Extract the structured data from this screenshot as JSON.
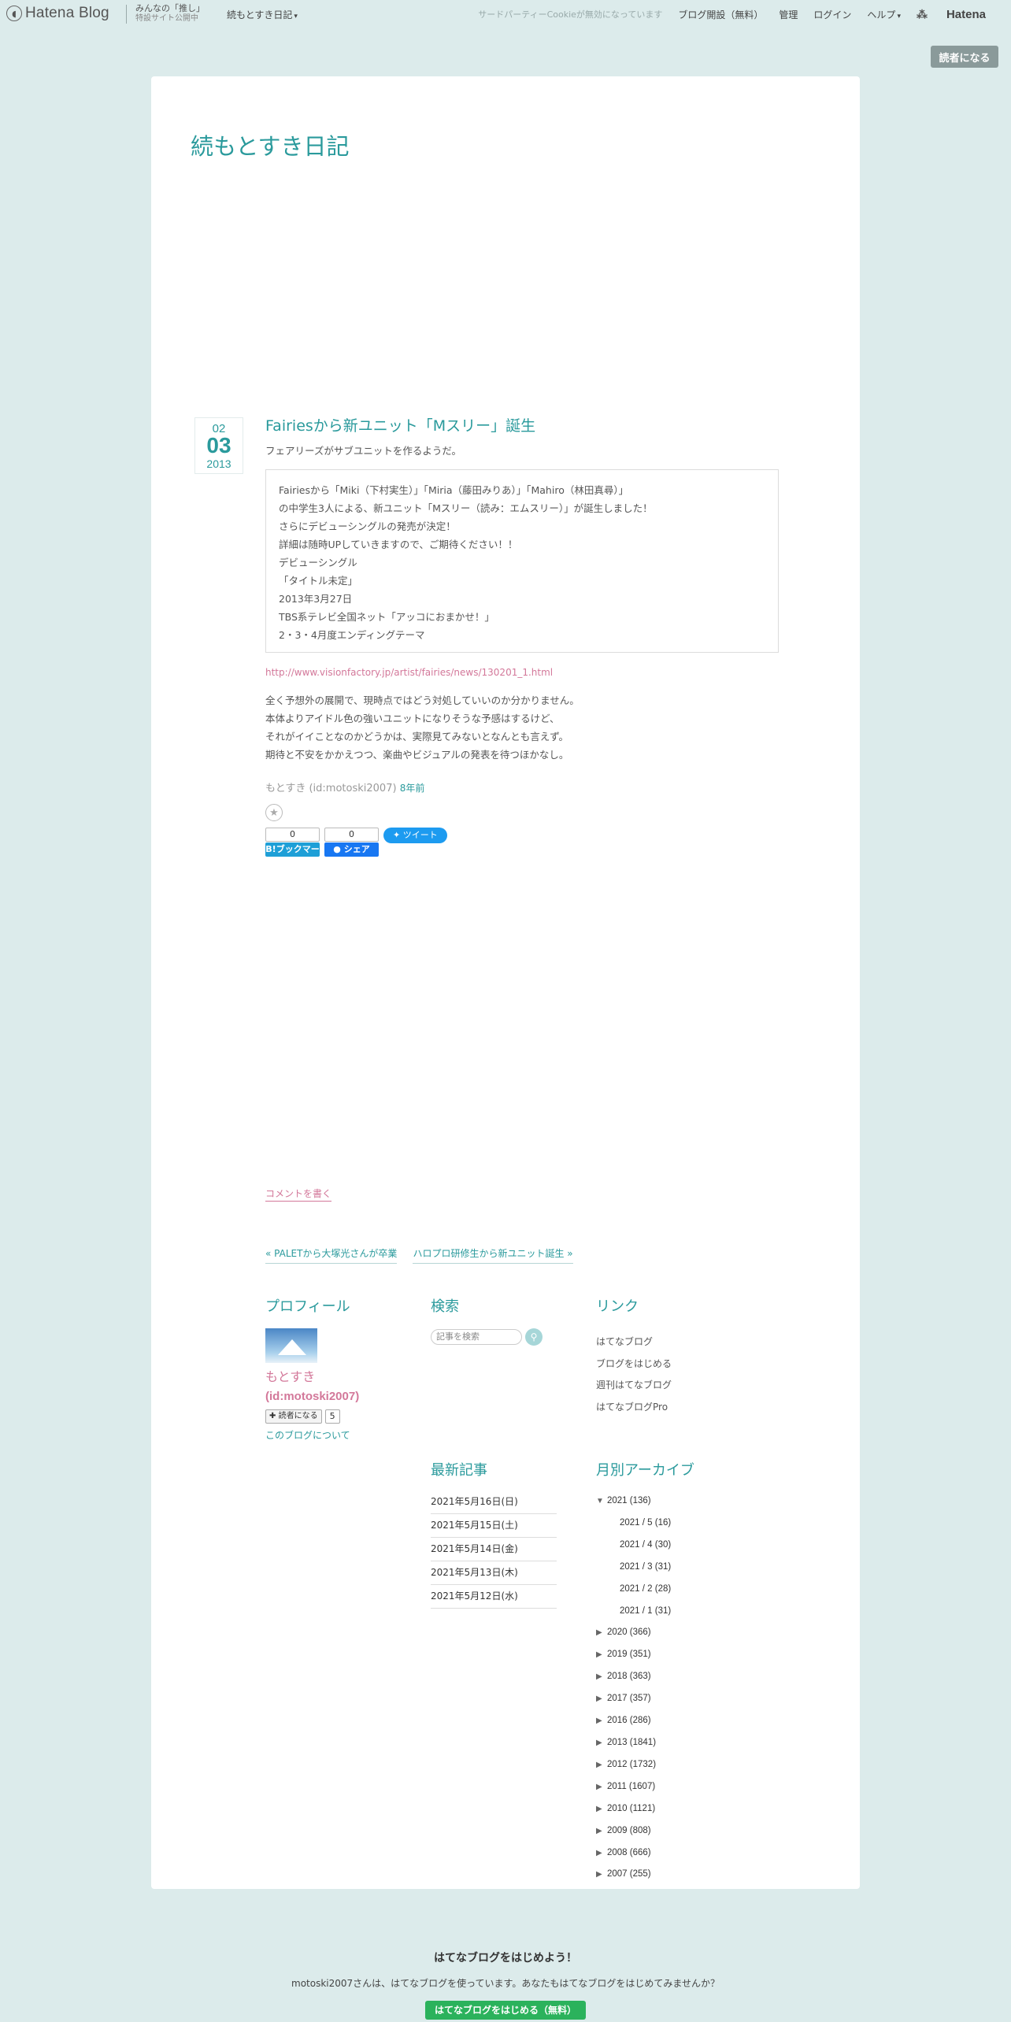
{
  "globalheader": {
    "logo": "Hatena Blog",
    "promo_line1": "みんなの「推し」",
    "promo_line2": "特設サイト公開中",
    "blog_menu": "続もとすき日記",
    "cookie_notice": "サードパーティーCookieが無効になっています",
    "start_blog": "ブログ開設（無料）",
    "admin": "管理",
    "login": "ログイン",
    "help": "ヘルプ",
    "hatena": "Hatena"
  },
  "subscribe_top": "読者になる",
  "blog": {
    "title": "続もとすき日記"
  },
  "entry": {
    "date": {
      "month": "02",
      "day": "03",
      "year": "2013"
    },
    "title": "Fairiesから新ユニット「Mスリー」誕生",
    "lead": "フェアリーズがサブユニットを作るようだ。",
    "quote": [
      "Fairiesから「Miki（下村実生）」「Miria（藤田みりあ）」「Mahiro（林田真尋）」",
      "の中学生3人による、新ユニット「Mスリー（読み：エムスリー）」が誕生しました！",
      "さらにデビューシングルの発売が決定！",
      "詳細は随時UPしていきますので、ご期待ください！！",
      "デビューシングル",
      "「タイトル未定」",
      "2013年3月27日",
      "TBS系テレビ全国ネット「アッコにおまかせ！」",
      "2・3・4月度エンディングテーマ"
    ],
    "source_link": "http://www.visionfactory.jp/artist/fairies/news/130201_1.html",
    "body": [
      "全く予想外の展開で、現時点ではどう対処していいのか分かりません。",
      "本体よりアイドル色の強いユニットになりそうな予感はするけど、",
      "それがイイことなのかどうかは、実際見てみないとなんとも言えず。",
      "期待と不安をかかえつつ、楽曲やビジュアルの発表を待つほかなし。"
    ],
    "author": "もとすき (id:motoski2007)",
    "ago": "8年前",
    "share": {
      "hatena_count": "0",
      "hatena_label": "B!ブックマーク",
      "fb_count": "0",
      "fb_label": "シェア",
      "tweet_label": "ツイート"
    },
    "comment_link": "コメントを書く"
  },
  "pager": {
    "prev": "« PALETから大塚光さんが卒業",
    "next": "ハロプロ研修生から新ユニット誕生 »"
  },
  "profile": {
    "title": "プロフィール",
    "name": "もとすき",
    "id": "(id:motoski2007)",
    "subscribe": "読者になる",
    "count": "5",
    "about": "このブログについて"
  },
  "search": {
    "title": "検索",
    "placeholder": "記事を検索"
  },
  "links": {
    "title": "リンク",
    "items": [
      "はてなブログ",
      "ブログをはじめる",
      "週刊はてなブログ",
      "はてなブログPro"
    ]
  },
  "recent": {
    "title": "最新記事",
    "items": [
      "2021年5月16日(日)",
      "2021年5月15日(土)",
      "2021年5月14日(金)",
      "2021年5月13日(木)",
      "2021年5月12日(水)"
    ]
  },
  "archive": {
    "title": "月別アーカイブ",
    "open_year": "2021 (136)",
    "months": [
      "2021 / 5 (16)",
      "2021 / 4 (30)",
      "2021 / 3 (31)",
      "2021 / 2 (28)",
      "2021 / 1 (31)"
    ],
    "years": [
      "2020 (366)",
      "2019 (351)",
      "2018 (363)",
      "2017 (357)",
      "2016 (286)",
      "2013 (1841)",
      "2012 (1732)",
      "2011 (1607)",
      "2010 (1121)",
      "2009 (808)",
      "2008 (666)",
      "2007 (255)"
    ]
  },
  "footer": {
    "head": "はてなブログをはじめよう！",
    "text": "motoski2007さんは、はてなブログを使っています。あなたもはてなブログをはじめてみませんか？",
    "cta": "はてなブログをはじめる（無料）"
  },
  "colors": {
    "accent": "#2a9a9c",
    "link_pink": "#d3789a",
    "background": "#dcebeb"
  }
}
